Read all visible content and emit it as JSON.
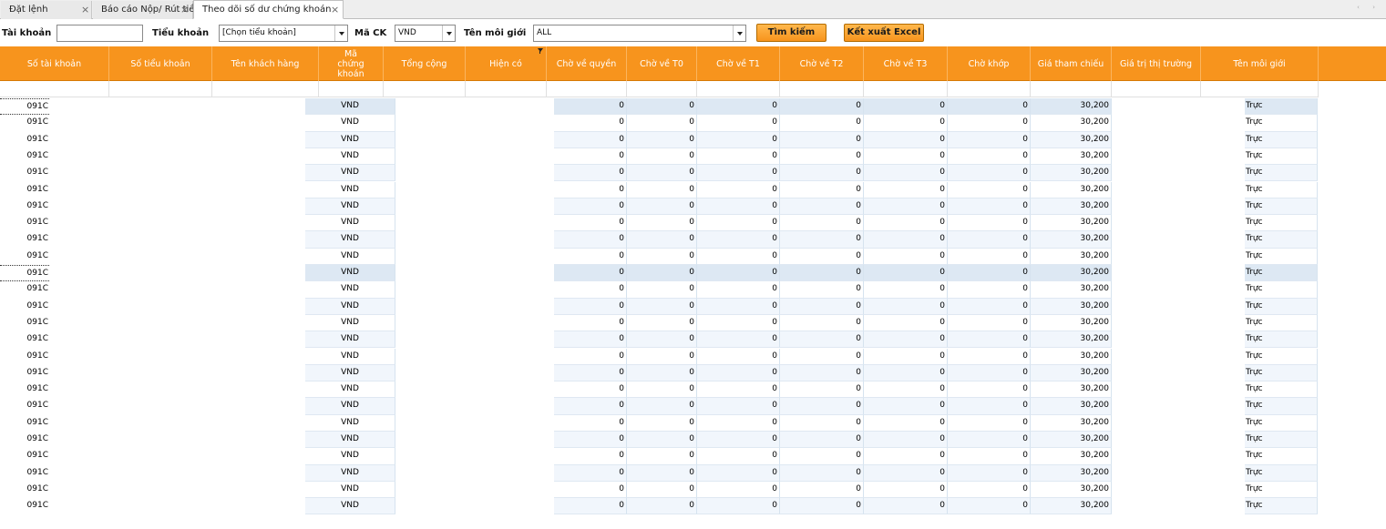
{
  "tabs": [
    {
      "label": "Đặt lệnh",
      "close": "×"
    },
    {
      "label": "Báo cáo Nộp/ Rút tiền",
      "close": "×"
    },
    {
      "label": "Theo dõi số dư chứng khoán",
      "close": "×"
    }
  ],
  "nav": {
    "arrows": "‹ ›"
  },
  "filters": {
    "account_label": "Tài khoản",
    "account_value": "",
    "subaccount_label": "Tiểu khoản",
    "subaccount_value": "[Chọn tiểu khoản]",
    "stock_label": "Mã CK",
    "stock_value": "VND",
    "broker_label": "Tên môi giới",
    "broker_value": "ALL",
    "search_button": "Tìm kiếm",
    "export_button": "Kết xuất Excel"
  },
  "columns": [
    "Số tài khoản",
    "Số tiểu khoản",
    "Tên khách hàng",
    "Mã chứng khoán",
    "Tổng cộng",
    "Hiện có",
    "Chờ về quyền",
    "Chờ về T0",
    "Chờ về T1",
    "Chờ về T2",
    "Chờ về T3",
    "Chờ khớp",
    "Giá tham chiếu",
    "Giá trị thị trường",
    "Tên môi giới"
  ],
  "rows": [
    {
      "account": "091C",
      "symbol": "VND",
      "cho_ve_quyen": "0",
      "t0": "0",
      "t1": "0",
      "t2": "0",
      "t3": "0",
      "cho_khop": "0",
      "gia_tham_chieu": "30,200",
      "broker": "Trực"
    },
    {
      "account": "091C",
      "symbol": "VND",
      "cho_ve_quyen": "0",
      "t0": "0",
      "t1": "0",
      "t2": "0",
      "t3": "0",
      "cho_khop": "0",
      "gia_tham_chieu": "30,200",
      "broker": "Trực"
    },
    {
      "account": "091C",
      "symbol": "VND",
      "cho_ve_quyen": "0",
      "t0": "0",
      "t1": "0",
      "t2": "0",
      "t3": "0",
      "cho_khop": "0",
      "gia_tham_chieu": "30,200",
      "broker": "Trực"
    },
    {
      "account": "091C",
      "symbol": "VND",
      "cho_ve_quyen": "0",
      "t0": "0",
      "t1": "0",
      "t2": "0",
      "t3": "0",
      "cho_khop": "0",
      "gia_tham_chieu": "30,200",
      "broker": "Trực"
    },
    {
      "account": "091C",
      "symbol": "VND",
      "cho_ve_quyen": "0",
      "t0": "0",
      "t1": "0",
      "t2": "0",
      "t3": "0",
      "cho_khop": "0",
      "gia_tham_chieu": "30,200",
      "broker": "Trực"
    },
    {
      "account": "091C",
      "symbol": "VND",
      "cho_ve_quyen": "0",
      "t0": "0",
      "t1": "0",
      "t2": "0",
      "t3": "0",
      "cho_khop": "0",
      "gia_tham_chieu": "30,200",
      "broker": "Trực"
    },
    {
      "account": "091C",
      "symbol": "VND",
      "cho_ve_quyen": "0",
      "t0": "0",
      "t1": "0",
      "t2": "0",
      "t3": "0",
      "cho_khop": "0",
      "gia_tham_chieu": "30,200",
      "broker": "Trực"
    },
    {
      "account": "091C",
      "symbol": "VND",
      "cho_ve_quyen": "0",
      "t0": "0",
      "t1": "0",
      "t2": "0",
      "t3": "0",
      "cho_khop": "0",
      "gia_tham_chieu": "30,200",
      "broker": "Trực"
    },
    {
      "account": "091C",
      "symbol": "VND",
      "cho_ve_quyen": "0",
      "t0": "0",
      "t1": "0",
      "t2": "0",
      "t3": "0",
      "cho_khop": "0",
      "gia_tham_chieu": "30,200",
      "broker": "Trực"
    },
    {
      "account": "091C",
      "symbol": "VND",
      "cho_ve_quyen": "0",
      "t0": "0",
      "t1": "0",
      "t2": "0",
      "t3": "0",
      "cho_khop": "0",
      "gia_tham_chieu": "30,200",
      "broker": "Trực"
    },
    {
      "account": "091C",
      "symbol": "VND",
      "cho_ve_quyen": "0",
      "t0": "0",
      "t1": "0",
      "t2": "0",
      "t3": "0",
      "cho_khop": "0",
      "gia_tham_chieu": "30,200",
      "broker": "Trực"
    },
    {
      "account": "091C",
      "symbol": "VND",
      "cho_ve_quyen": "0",
      "t0": "0",
      "t1": "0",
      "t2": "0",
      "t3": "0",
      "cho_khop": "0",
      "gia_tham_chieu": "30,200",
      "broker": "Trực"
    },
    {
      "account": "091C",
      "symbol": "VND",
      "cho_ve_quyen": "0",
      "t0": "0",
      "t1": "0",
      "t2": "0",
      "t3": "0",
      "cho_khop": "0",
      "gia_tham_chieu": "30,200",
      "broker": "Trực"
    },
    {
      "account": "091C",
      "symbol": "VND",
      "cho_ve_quyen": "0",
      "t0": "0",
      "t1": "0",
      "t2": "0",
      "t3": "0",
      "cho_khop": "0",
      "gia_tham_chieu": "30,200",
      "broker": "Trực"
    },
    {
      "account": "091C",
      "symbol": "VND",
      "cho_ve_quyen": "0",
      "t0": "0",
      "t1": "0",
      "t2": "0",
      "t3": "0",
      "cho_khop": "0",
      "gia_tham_chieu": "30,200",
      "broker": "Trực"
    },
    {
      "account": "091C",
      "symbol": "VND",
      "cho_ve_quyen": "0",
      "t0": "0",
      "t1": "0",
      "t2": "0",
      "t3": "0",
      "cho_khop": "0",
      "gia_tham_chieu": "30,200",
      "broker": "Trực"
    },
    {
      "account": "091C",
      "symbol": "VND",
      "cho_ve_quyen": "0",
      "t0": "0",
      "t1": "0",
      "t2": "0",
      "t3": "0",
      "cho_khop": "0",
      "gia_tham_chieu": "30,200",
      "broker": "Trực"
    },
    {
      "account": "091C",
      "symbol": "VND",
      "cho_ve_quyen": "0",
      "t0": "0",
      "t1": "0",
      "t2": "0",
      "t3": "0",
      "cho_khop": "0",
      "gia_tham_chieu": "30,200",
      "broker": "Trực"
    },
    {
      "account": "091C",
      "symbol": "VND",
      "cho_ve_quyen": "0",
      "t0": "0",
      "t1": "0",
      "t2": "0",
      "t3": "0",
      "cho_khop": "0",
      "gia_tham_chieu": "30,200",
      "broker": "Trực"
    },
    {
      "account": "091C",
      "symbol": "VND",
      "cho_ve_quyen": "0",
      "t0": "0",
      "t1": "0",
      "t2": "0",
      "t3": "0",
      "cho_khop": "0",
      "gia_tham_chieu": "30,200",
      "broker": "Trực"
    },
    {
      "account": "091C",
      "symbol": "VND",
      "cho_ve_quyen": "0",
      "t0": "0",
      "t1": "0",
      "t2": "0",
      "t3": "0",
      "cho_khop": "0",
      "gia_tham_chieu": "30,200",
      "broker": "Trực"
    },
    {
      "account": "091C",
      "symbol": "VND",
      "cho_ve_quyen": "0",
      "t0": "0",
      "t1": "0",
      "t2": "0",
      "t3": "0",
      "cho_khop": "0",
      "gia_tham_chieu": "30,200",
      "broker": "Trực"
    },
    {
      "account": "091C",
      "symbol": "VND",
      "cho_ve_quyen": "0",
      "t0": "0",
      "t1": "0",
      "t2": "0",
      "t3": "0",
      "cho_khop": "0",
      "gia_tham_chieu": "30,200",
      "broker": "Trực"
    },
    {
      "account": "091C",
      "symbol": "VND",
      "cho_ve_quyen": "0",
      "t0": "0",
      "t1": "0",
      "t2": "0",
      "t3": "0",
      "cho_khop": "0",
      "gia_tham_chieu": "30,200",
      "broker": "Trực"
    },
    {
      "account": "091C",
      "symbol": "VND",
      "cho_ve_quyen": "0",
      "t0": "0",
      "t1": "0",
      "t2": "0",
      "t3": "0",
      "cho_khop": "0",
      "gia_tham_chieu": "30,200",
      "broker": "Trực"
    }
  ],
  "colors": {
    "header_bg": "#f7941d",
    "button_bg": "#f7941d",
    "row_shade": "#f1f6fc"
  }
}
